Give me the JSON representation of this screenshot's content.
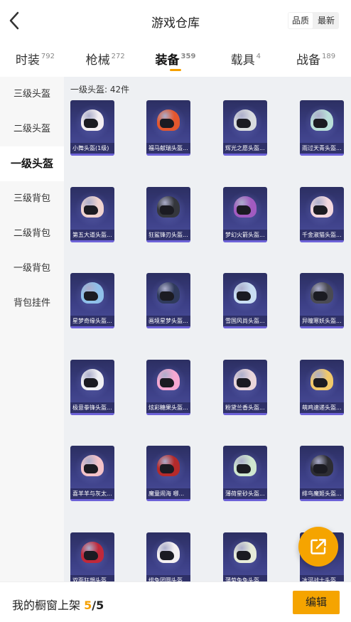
{
  "header": {
    "title": "游戏仓库",
    "sort_options": [
      "品质",
      "最新"
    ],
    "sort_active": 0
  },
  "tabs": [
    {
      "label": "时装",
      "count": "792"
    },
    {
      "label": "枪械",
      "count": "272"
    },
    {
      "label": "装备",
      "count": "359"
    },
    {
      "label": "载具",
      "count": "4"
    },
    {
      "label": "战备",
      "count": "189"
    }
  ],
  "active_tab": 2,
  "sidebar": {
    "items": [
      {
        "label": "三级头盔"
      },
      {
        "label": "二级头盔"
      },
      {
        "label": "一级头盔"
      },
      {
        "label": "三级背包"
      },
      {
        "label": "二级背包"
      },
      {
        "label": "一级背包"
      },
      {
        "label": "背包挂件"
      }
    ],
    "active": 2
  },
  "main": {
    "category_heading": "一级头盔: 42件",
    "items": [
      {
        "label": "小舞头盔(1级)",
        "color": "#f3eef2"
      },
      {
        "label": "福马献瑞头盔...",
        "color": "#e4572e"
      },
      {
        "label": "辉光之愿头盔...",
        "color": "#d9dcdf"
      },
      {
        "label": "雨过天青头盔...",
        "color": "#b9dfd9"
      },
      {
        "label": "第五大道头盔...",
        "color": "#f0d3cf"
      },
      {
        "label": "狂鲨锋刃头盔...",
        "color": "#34363c"
      },
      {
        "label": "梦幻火箭头盔...",
        "color": "#a25bc0"
      },
      {
        "label": "千金淑猫头盔...",
        "color": "#f3d8de"
      },
      {
        "label": "星梦奇缘头盔...",
        "color": "#8fc0ea"
      },
      {
        "label": "画境星梦头盔...",
        "color": "#2f3a5c"
      },
      {
        "label": "雪国风尚头盔...",
        "color": "#c9def3"
      },
      {
        "label": "异瞳寒妖头盔...",
        "color": "#4a4a52"
      },
      {
        "label": "极意拳锋头盔...",
        "color": "#f0f0f4"
      },
      {
        "label": "炫彩糖果头盔...",
        "color": "#f6a8d2"
      },
      {
        "label": "粉黛兰香头盔...",
        "color": "#ead6da"
      },
      {
        "label": "萌鸡速递头盔...",
        "color": "#f1c96a"
      },
      {
        "label": "喜羊羊与灰太...",
        "color": "#f4c2c8"
      },
      {
        "label": "魔童闹海 哪...",
        "color": "#b52a2a"
      },
      {
        "label": "薄荷星砂头盔...",
        "color": "#cfe7cf"
      },
      {
        "label": "绯鸟魔姬头盔...",
        "color": "#2d2d33"
      },
      {
        "label": "双面狂想头盔...",
        "color": "#c0283a"
      },
      {
        "label": "绯兔团圆头盔...",
        "color": "#f4f0f2"
      },
      {
        "label": "蒲菊兔兔头盔...",
        "color": "#e7ecd9"
      },
      {
        "label": "冰河战士头盔...",
        "color": "#e8e8ea"
      }
    ]
  },
  "bottom": {
    "shelf_label": "我的橱窗上架",
    "shelf_count": "5",
    "shelf_total": "/5",
    "edit_label": "编辑"
  },
  "colors": {
    "accent": "#f5a400",
    "card_bg": "#3c3f86",
    "card_border": "#6d62d8"
  },
  "icons": {
    "back": "chevron-left-icon",
    "share": "external-link-icon"
  }
}
